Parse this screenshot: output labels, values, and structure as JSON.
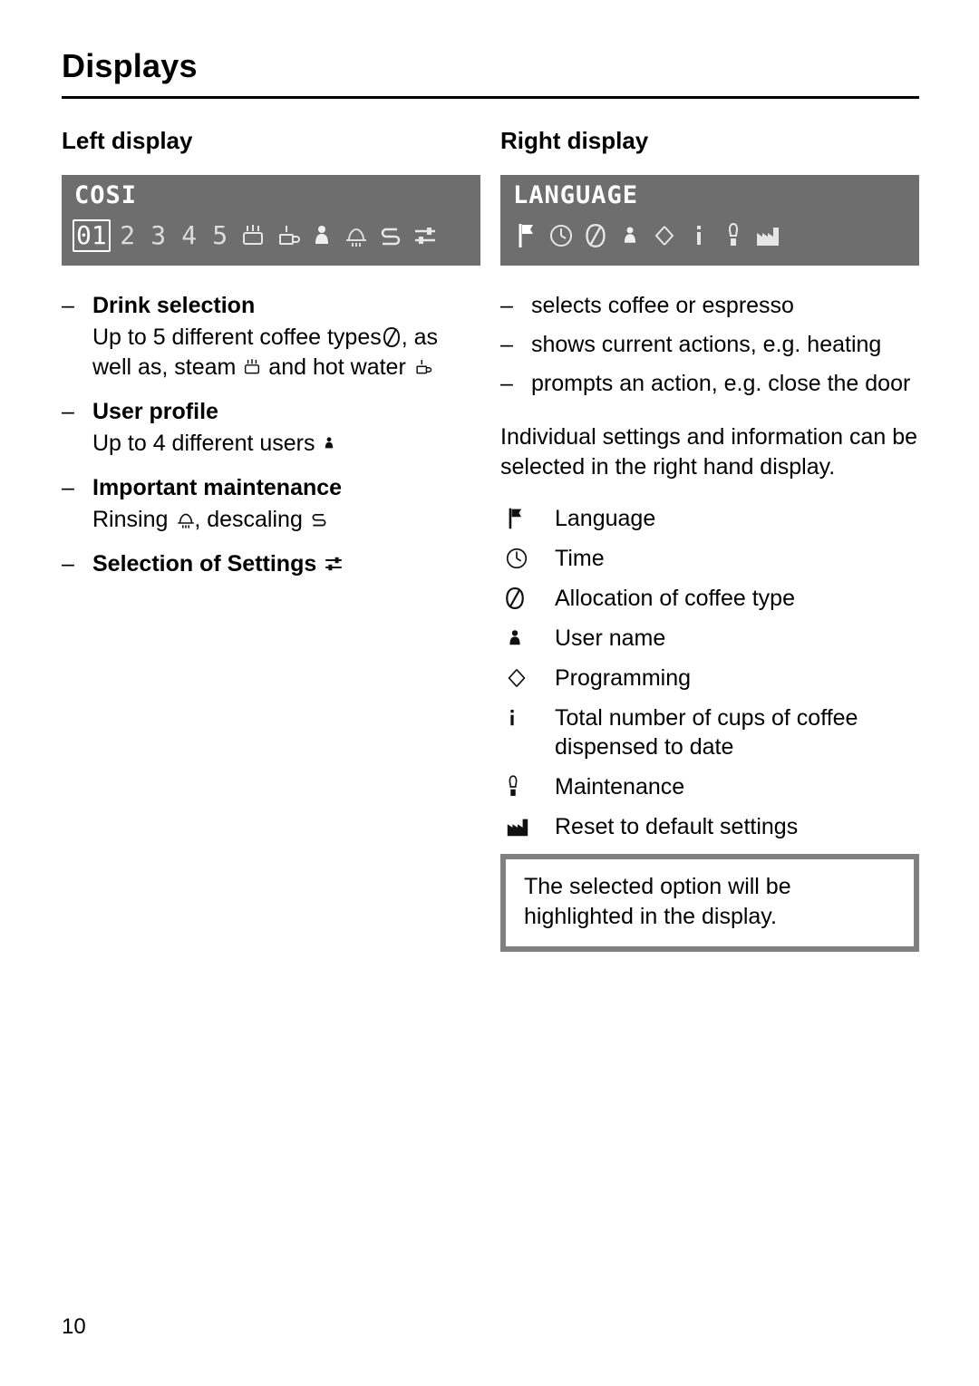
{
  "page": {
    "title": "Displays",
    "folio": "10"
  },
  "left": {
    "heading": "Left display",
    "display": {
      "word": "COSI",
      "cells": [
        "01",
        "2",
        "3",
        "4",
        "5"
      ],
      "icons": [
        "steam-icon",
        "hot-water-icon",
        "user-profile-icon",
        "rinsing-icon",
        "descaling-icon",
        "settings-icon"
      ]
    },
    "items": [
      {
        "dash": "–",
        "term": "Drink selection",
        "desc_a": "Up to 5 different coffee types",
        "desc_icon_a": "coffee-bean-icon",
        "desc_b": ", as well as, steam",
        "desc_icon_b": "steam-icon",
        "desc_c": "and hot water",
        "desc_icon_c": "hot-water-icon"
      },
      {
        "dash": "–",
        "term": "User profile",
        "desc_a": "Up to 4 different users",
        "desc_icon_a": "user-profile-icon"
      },
      {
        "dash": "–",
        "term": "Important maintenance",
        "desc_a": "Rinsing",
        "desc_icon_a": "rinsing-icon",
        "desc_b": ", descaling",
        "desc_icon_b": "descaling-icon"
      },
      {
        "dash": "–",
        "term": "Selection of Settings",
        "desc_icon_a": "settings-icon"
      }
    ]
  },
  "right": {
    "heading": "Right display",
    "display": {
      "word": "LANGUAGE",
      "icons": [
        "language-flag-icon",
        "time-clock-icon",
        "coffee-bean-icon",
        "user-name-icon",
        "programming-arrow-icon",
        "info-icon",
        "maintenance-icon",
        "reset-factory-icon"
      ]
    },
    "bullets": [
      "selects coffee or espresso",
      "shows current actions, e.g. heating",
      "prompts an action, e.g. close the door"
    ],
    "dash": "–",
    "paragraph": "Individual settings and information can be selected in the right hand display.",
    "legend": [
      {
        "icon": "language-flag-icon",
        "label": "Language"
      },
      {
        "icon": "time-clock-icon",
        "label": "Time"
      },
      {
        "icon": "coffee-bean-icon",
        "label": "Allocation of coffee type"
      },
      {
        "icon": "user-name-icon",
        "label": "User name"
      },
      {
        "icon": "programming-arrow-icon",
        "label": "Programming"
      },
      {
        "icon": "info-icon",
        "label": "Total number of cups of coffee dispensed to date"
      },
      {
        "icon": "maintenance-icon",
        "label": "Maintenance"
      },
      {
        "icon": "reset-factory-icon",
        "label": "Reset to default settings"
      }
    ],
    "note": "The selected option will be highlighted in the display."
  }
}
